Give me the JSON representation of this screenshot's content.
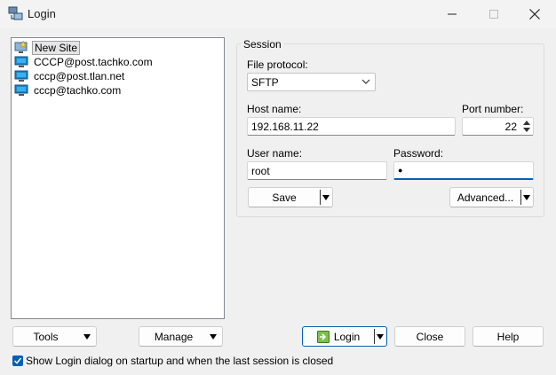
{
  "window": {
    "title": "Login"
  },
  "sites": [
    {
      "label": "New Site",
      "selected": true
    },
    {
      "label": "CCCP@post.tachko.com",
      "selected": false
    },
    {
      "label": "cccp@post.tlan.net",
      "selected": false
    },
    {
      "label": "cccp@tachko.com",
      "selected": false
    }
  ],
  "session": {
    "group_title": "Session",
    "file_protocol_label": "File protocol:",
    "file_protocol_value": "SFTP",
    "host_name_label": "Host name:",
    "host_name_value": "192.168.11.22",
    "port_label": "Port number:",
    "port_value": "22",
    "user_name_label": "User name:",
    "user_name_value": "root",
    "password_label": "Password:",
    "password_value": "●",
    "save_label": "Save",
    "advanced_label": "Advanced..."
  },
  "footer": {
    "tools_label": "Tools",
    "manage_label": "Manage",
    "login_label": "Login",
    "close_label": "Close",
    "help_label": "Help",
    "show_login_checkbox_label": "Show Login dialog on startup and when the last session is closed",
    "show_login_checked": true
  },
  "colors": {
    "accent": "#005fb8",
    "background": "#f0f0f0"
  }
}
